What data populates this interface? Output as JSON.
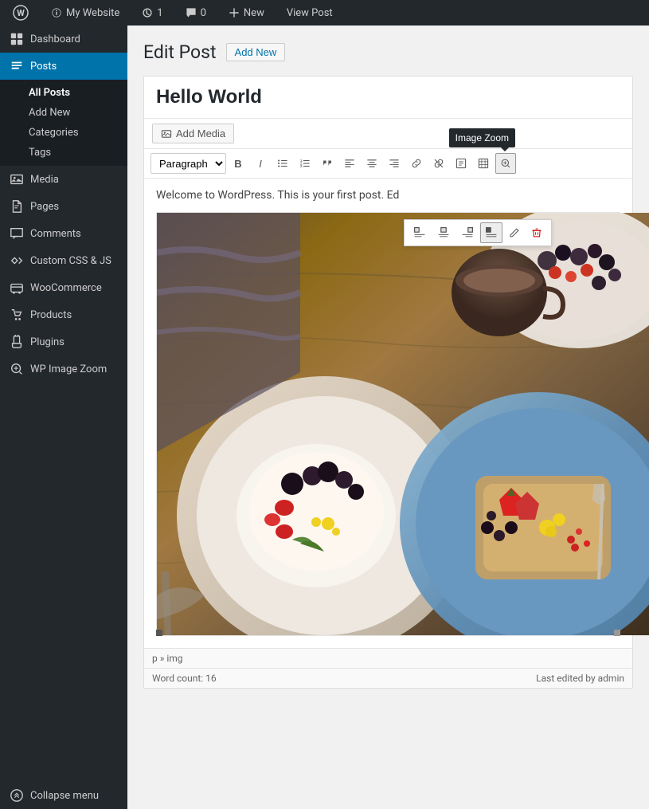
{
  "adminbar": {
    "logo_label": "WordPress",
    "site_name": "My Website",
    "updates_count": "1",
    "comments_count": "0",
    "new_label": "New",
    "view_post_label": "View Post"
  },
  "sidebar": {
    "dashboard_label": "Dashboard",
    "posts_label": "Posts",
    "all_posts_label": "All Posts",
    "add_new_label": "Add New",
    "categories_label": "Categories",
    "tags_label": "Tags",
    "media_label": "Media",
    "pages_label": "Pages",
    "comments_label": "Comments",
    "custom_css_label": "Custom CSS & JS",
    "woocommerce_label": "WooCommerce",
    "products_label": "Products",
    "plugins_label": "Plugins",
    "wp_image_zoom_label": "WP Image Zoom",
    "collapse_label": "Collapse menu"
  },
  "header": {
    "title": "Edit Post",
    "add_new_btn": "Add New"
  },
  "toolbar": {
    "add_media_label": "Add Media",
    "format_paragraph": "Paragraph",
    "bold": "B",
    "italic": "I",
    "image_zoom_tooltip": "Image Zoom"
  },
  "post": {
    "title": "Hello World",
    "content_text": "Welcome to WordPress. This is your first post. Ed",
    "path": "p » img",
    "word_count": "Word count: 16",
    "last_edited": "Last edited by admin"
  },
  "image_toolbar": {
    "align_left": "align-left",
    "align_center": "align-center",
    "align_right": "align-right",
    "align_none": "align-none",
    "edit": "edit",
    "delete": "delete"
  }
}
